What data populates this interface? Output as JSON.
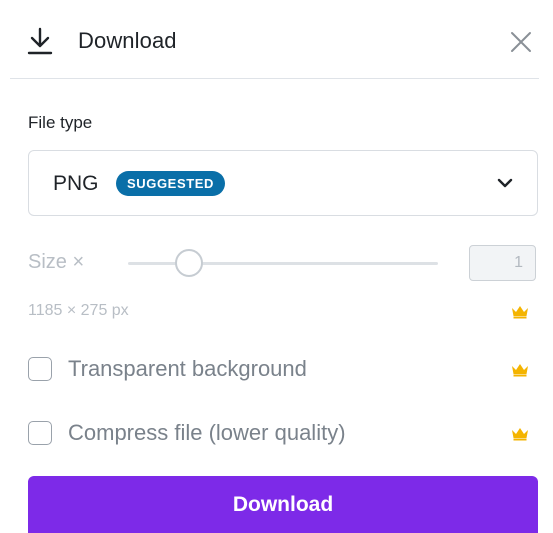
{
  "header": {
    "title": "Download",
    "download_icon": "download-icon",
    "close_icon": "close-icon"
  },
  "file_type": {
    "label": "File type",
    "selected_value": "PNG",
    "badge": "SUGGESTED",
    "dropdown_icon": "chevron-down-icon"
  },
  "size": {
    "label": "Size ×",
    "value": "1",
    "slider_value": 1,
    "dimensions": "1185 × 275 px"
  },
  "options": {
    "transparent_background": {
      "label": "Transparent background",
      "checked": false
    },
    "compress_file": {
      "label": "Compress file (lower quality)",
      "checked": false
    }
  },
  "premium_icon": "crown-icon",
  "download_button": {
    "label": "Download"
  },
  "colors": {
    "primary": "#7d2ae8",
    "badge": "#0a6fa8",
    "crown": "#f4b400",
    "disabled_text": "#b8bec5"
  }
}
